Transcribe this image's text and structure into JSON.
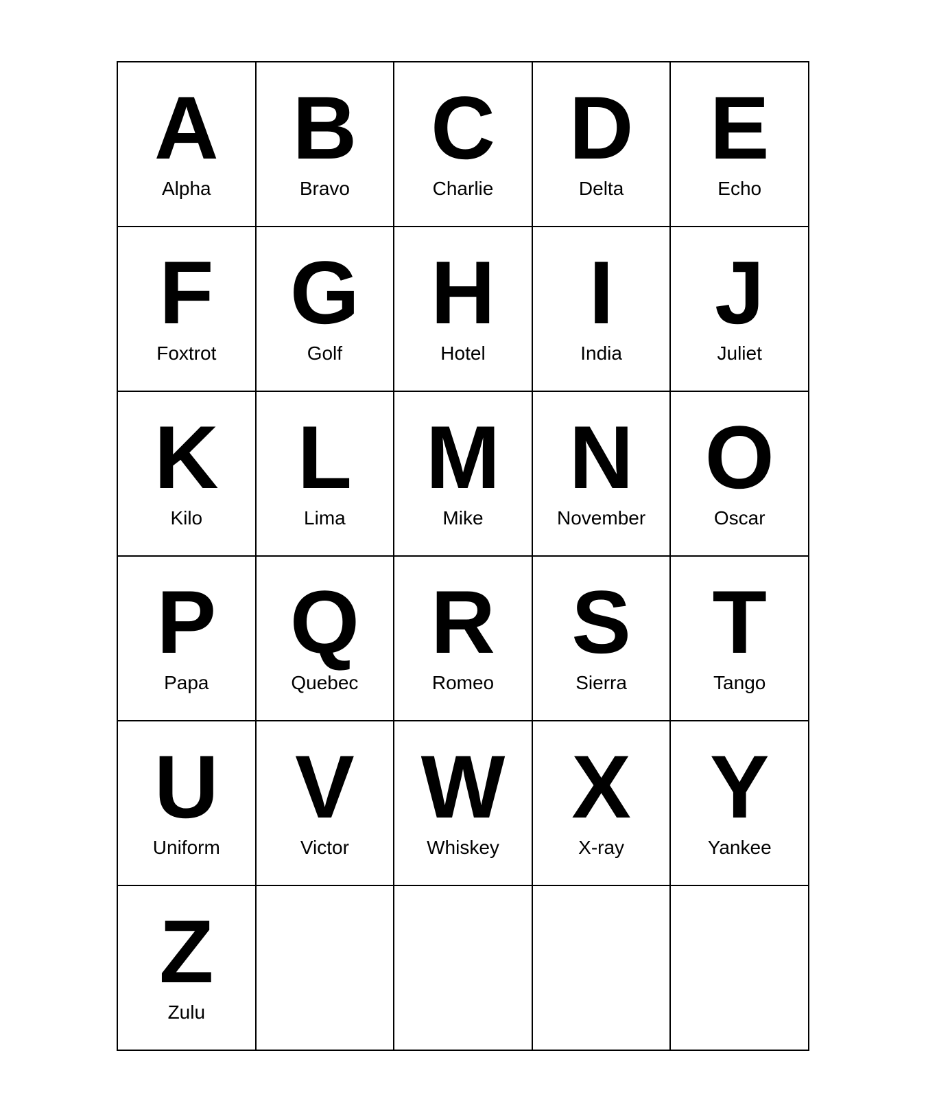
{
  "alphabet": [
    {
      "letter": "A",
      "word": "Alpha"
    },
    {
      "letter": "B",
      "word": "Bravo"
    },
    {
      "letter": "C",
      "word": "Charlie"
    },
    {
      "letter": "D",
      "word": "Delta"
    },
    {
      "letter": "E",
      "word": "Echo"
    },
    {
      "letter": "F",
      "word": "Foxtrot"
    },
    {
      "letter": "G",
      "word": "Golf"
    },
    {
      "letter": "H",
      "word": "Hotel"
    },
    {
      "letter": "I",
      "word": "India"
    },
    {
      "letter": "J",
      "word": "Juliet"
    },
    {
      "letter": "K",
      "word": "Kilo"
    },
    {
      "letter": "L",
      "word": "Lima"
    },
    {
      "letter": "M",
      "word": "Mike"
    },
    {
      "letter": "N",
      "word": "November"
    },
    {
      "letter": "O",
      "word": "Oscar"
    },
    {
      "letter": "P",
      "word": "Papa"
    },
    {
      "letter": "Q",
      "word": "Quebec"
    },
    {
      "letter": "R",
      "word": "Romeo"
    },
    {
      "letter": "S",
      "word": "Sierra"
    },
    {
      "letter": "T",
      "word": "Tango"
    },
    {
      "letter": "U",
      "word": "Uniform"
    },
    {
      "letter": "V",
      "word": "Victor"
    },
    {
      "letter": "W",
      "word": "Whiskey"
    },
    {
      "letter": "X",
      "word": "X-ray"
    },
    {
      "letter": "Y",
      "word": "Yankee"
    },
    {
      "letter": "Z",
      "word": "Zulu"
    }
  ]
}
